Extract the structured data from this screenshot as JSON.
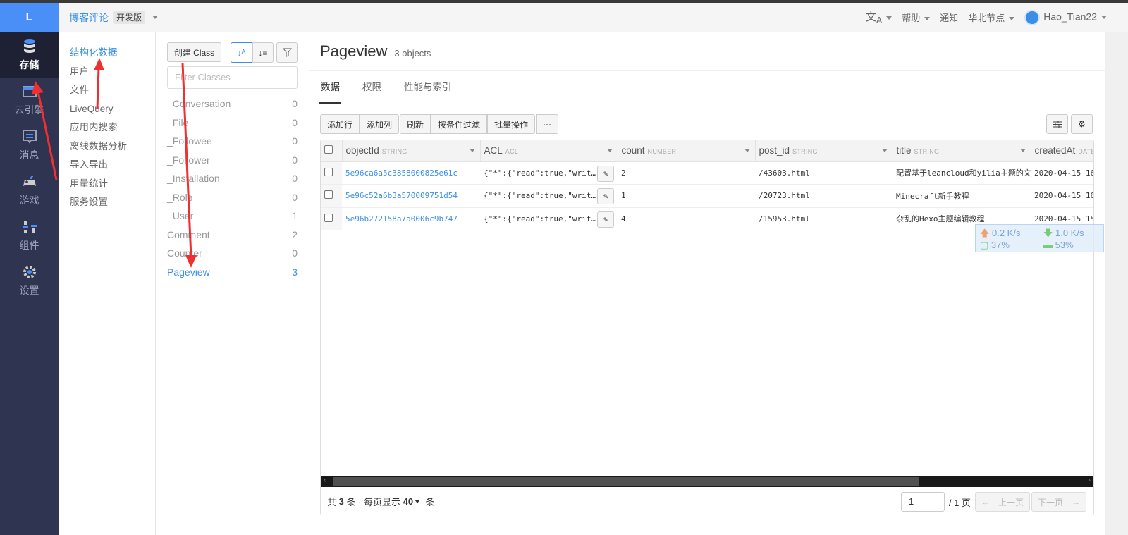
{
  "logo": "L",
  "nav": [
    {
      "label": "存储",
      "icon": "database-icon"
    },
    {
      "label": "云引擎",
      "icon": "cloud-engine-icon"
    },
    {
      "label": "消息",
      "icon": "message-icon"
    },
    {
      "label": "游戏",
      "icon": "gamepad-icon"
    },
    {
      "label": "组件",
      "icon": "components-icon"
    },
    {
      "label": "设置",
      "icon": "gear-icon"
    }
  ],
  "header": {
    "app_name": "博客评论",
    "edition": "开发版",
    "help": "帮助",
    "notify": "通知",
    "region": "华北节点",
    "user": "Hao_Tian22"
  },
  "submenu": [
    "结构化数据",
    "用户",
    "文件",
    "LiveQuery",
    "应用内搜索",
    "离线数据分析",
    "导入导出",
    "用量统计",
    "服务设置"
  ],
  "classes_panel": {
    "create_label": "创建 Class",
    "filter_placeholder": "Filter Classes",
    "items": [
      {
        "name": "_Conversation",
        "count": "0"
      },
      {
        "name": "_File",
        "count": "0"
      },
      {
        "name": "_Followee",
        "count": "0"
      },
      {
        "name": "_Follower",
        "count": "0"
      },
      {
        "name": "_Installation",
        "count": "0"
      },
      {
        "name": "_Role",
        "count": "0"
      },
      {
        "name": "_User",
        "count": "1"
      },
      {
        "name": "Comment",
        "count": "2"
      },
      {
        "name": "Counter",
        "count": "0"
      },
      {
        "name": "Pageview",
        "count": "3"
      }
    ]
  },
  "main": {
    "title": "Pageview",
    "subtitle": "3 objects",
    "tabs": [
      "数据",
      "权限",
      "性能与索引"
    ],
    "toolbar": {
      "add_row": "添加行",
      "add_col": "添加列",
      "refresh": "刷新",
      "filter": "按条件过滤",
      "batch": "批量操作",
      "more": "···"
    },
    "columns": [
      {
        "name": "objectId",
        "type": "STRING"
      },
      {
        "name": "ACL",
        "type": "ACL"
      },
      {
        "name": "count",
        "type": "NUMBER"
      },
      {
        "name": "post_id",
        "type": "STRING"
      },
      {
        "name": "title",
        "type": "STRING"
      },
      {
        "name": "createdAt",
        "type": "DATE"
      }
    ],
    "rows": [
      {
        "objectId": "5e96ca6a5c3858000825e61c",
        "acl": "{\"*\":{\"read\":true,\"writ…",
        "count": "2",
        "post_id": "/43603.html",
        "title": "配置基于leancloud和yilia主题的文",
        "createdAt": "2020-04-15 16"
      },
      {
        "objectId": "5e96c52a6b3a570009751d54",
        "acl": "{\"*\":{\"read\":true,\"writ…",
        "count": "1",
        "post_id": "/20723.html",
        "title": "Minecraft新手教程",
        "createdAt": "2020-04-15 16"
      },
      {
        "objectId": "5e96b272158a7a0006c9b747",
        "acl": "{\"*\":{\"read\":true,\"writ…",
        "count": "4",
        "post_id": "/15953.html",
        "title": "杂乱的Hexo主题编辑教程",
        "createdAt": "2020-04-15 15"
      }
    ],
    "footer": {
      "total_prefix": "共",
      "total": "3",
      "total_suffix": "条 · 每页显示",
      "per_page": "40",
      "per_page_suffix": "条",
      "page": "1",
      "page_total": "/ 1 页",
      "prev": "上一页",
      "next": "下一页"
    }
  },
  "net_widget": {
    "up": "0.2 K/s",
    "down": "1.0 K/s",
    "cpu": "37%",
    "mem": "53%"
  }
}
